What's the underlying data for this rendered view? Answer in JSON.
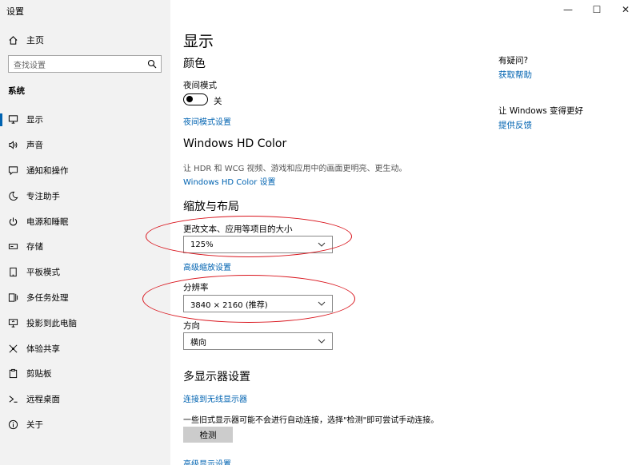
{
  "window": {
    "title": "设置",
    "controls": {
      "minimize": "—",
      "maximize": "☐",
      "close": "✕"
    }
  },
  "sidebar": {
    "home": "主页",
    "search_placeholder": "查找设置",
    "section": "系统",
    "items": [
      {
        "label": "显示",
        "icon": "monitor-icon",
        "active": true
      },
      {
        "label": "声音",
        "icon": "speaker-icon"
      },
      {
        "label": "通知和操作",
        "icon": "notification-icon"
      },
      {
        "label": "专注助手",
        "icon": "moon-icon"
      },
      {
        "label": "电源和睡眠",
        "icon": "power-icon"
      },
      {
        "label": "存储",
        "icon": "storage-icon"
      },
      {
        "label": "平板模式",
        "icon": "tablet-icon"
      },
      {
        "label": "多任务处理",
        "icon": "multitask-icon"
      },
      {
        "label": "投影到此电脑",
        "icon": "project-icon"
      },
      {
        "label": "体验共享",
        "icon": "share-icon"
      },
      {
        "label": "剪贴板",
        "icon": "clipboard-icon"
      },
      {
        "label": "远程桌面",
        "icon": "remote-icon"
      },
      {
        "label": "关于",
        "icon": "info-icon"
      }
    ]
  },
  "main": {
    "title": "显示",
    "color_heading": "颜色",
    "night_mode_label": "夜间模式",
    "night_mode_state": "关",
    "night_mode_link": "夜间模式设置",
    "hdr_heading": "Windows HD Color",
    "hdr_desc": "让 HDR 和 WCG 视频、游戏和应用中的画面更明亮、更生动。",
    "hdr_link": "Windows HD Color 设置",
    "scale_heading": "缩放与布局",
    "scale_label": "更改文本、应用等项目的大小",
    "scale_value": "125%",
    "advanced_scale_link": "高级缩放设置",
    "resolution_label": "分辨率",
    "resolution_value": "3840 × 2160 (推荐)",
    "orientation_label": "方向",
    "orientation_value": "横向",
    "multi_display_heading": "多显示器设置",
    "wireless_link": "连接到无线显示器",
    "detect_desc": "一些旧式显示器可能不会进行自动连接，选择\"检测\"即可尝试手动连接。",
    "detect_button": "检测",
    "advanced_display_link": "高级显示设置"
  },
  "right": {
    "question": "有疑问?",
    "help_link": "获取帮助",
    "improve": "让 Windows 变得更好",
    "feedback_link": "提供反馈"
  },
  "colors": {
    "accent": "#0063b1",
    "annotation": "#d9151d",
    "sidebar_bg": "#f2f2f2"
  }
}
